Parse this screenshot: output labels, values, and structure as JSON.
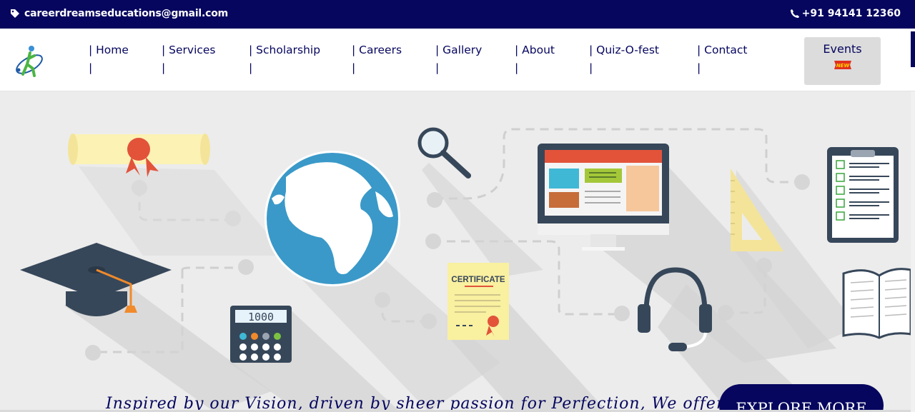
{
  "topbar": {
    "email": "careerdreamseducations@gmail.com",
    "phone": "+91 94141 12360"
  },
  "nav": {
    "items": [
      {
        "label": "| Home",
        "bar": "|"
      },
      {
        "label": "| Services",
        "bar": "|"
      },
      {
        "label": "| Scholarship",
        "bar": "|"
      },
      {
        "label": "| Careers",
        "bar": "|"
      },
      {
        "label": "| Gallery",
        "bar": "|"
      },
      {
        "label": "| About",
        "bar": "|"
      },
      {
        "label": "| Quiz-O-fest",
        "bar": "|"
      },
      {
        "label": "| Contact",
        "bar": "|"
      }
    ],
    "events_label": "Events",
    "new_badge": "NEW"
  },
  "hero": {
    "calculator_display": "1000",
    "certificate_title": "CERTIFICATE",
    "tagline": "Inspired by our Vision, driven by sheer passion for Perfection, We offer",
    "explore_label": "EXPLORE MORE"
  },
  "colors": {
    "navy": "#06065f",
    "hero_bg": "#ececec",
    "accent_red": "#e2533a"
  }
}
